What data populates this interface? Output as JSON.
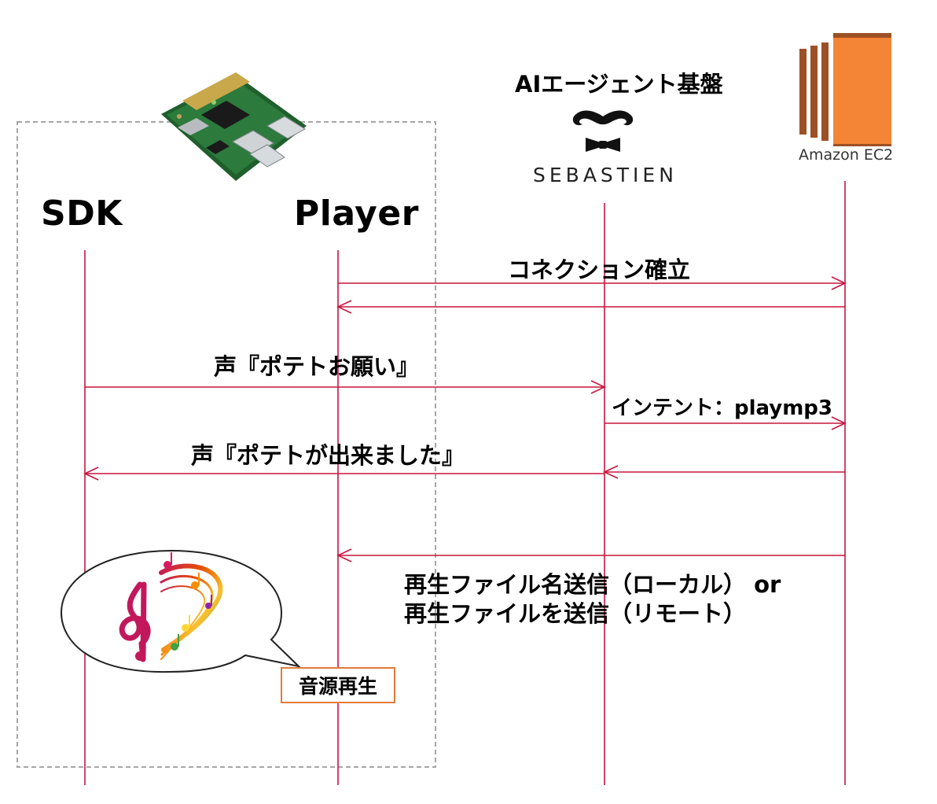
{
  "participants": {
    "sdk": "SDK",
    "player": "Player",
    "agent_heading": "AIエージェント基盤",
    "agent_logo_text": "SEBASTIEN",
    "ec2_caption": "Amazon EC2"
  },
  "messages": {
    "connection": "コネクション確立",
    "voice_request": "声『ポテトお願い』",
    "intent": "インテント：playmp3",
    "voice_reply": "声『ポテトが出来ました』",
    "file_line1": "再生ファイル名送信（ローカル） or",
    "file_line2": "再生ファイルを送信（リモート）"
  },
  "playback_box": "音源再生",
  "colors": {
    "lifeline": "#c8153f",
    "device_boundary": "#a6a6a6",
    "box_border": "#e07b39",
    "ec2_orange": "#f58536",
    "ec2_dark": "#9d5025"
  },
  "icons": [
    "raspberry-pi-board-image",
    "mustache-bowtie-logo",
    "amazon-ec2-icon",
    "music-notes-icon"
  ]
}
